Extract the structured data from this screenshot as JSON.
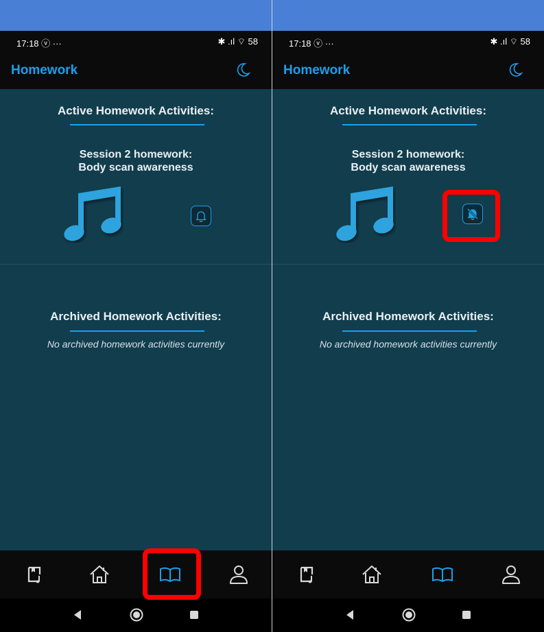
{
  "phones": [
    {
      "status": {
        "time": "17:18 ⓥ ···",
        "icons": "✱ .ıl ⌔ 58"
      },
      "header": {
        "title": "Homework",
        "theme_icon": "moon-icon"
      },
      "active": {
        "title": "Active Homework Activities:",
        "session_line1": "Session 2 homework:",
        "session_line2": "Body scan awareness",
        "media_icon": "music-note-icon",
        "reminder_icon": "bell-icon",
        "reminder_state": "on"
      },
      "archived": {
        "title": "Archived Homework Activities:",
        "empty_text": "No archived homework activities currently"
      },
      "nav": {
        "tabs": [
          "music-book-icon",
          "home-icon",
          "book-icon",
          "person-icon"
        ],
        "active_tab": "book-icon"
      },
      "highlight_target": "book-tab"
    },
    {
      "status": {
        "time": "17:18 ⓥ ···",
        "icons": "✱ .ıl ⌔ 58"
      },
      "header": {
        "title": "Homework",
        "theme_icon": "moon-icon"
      },
      "active": {
        "title": "Active Homework Activities:",
        "session_line1": "Session 2 homework:",
        "session_line2": "Body scan awareness",
        "media_icon": "music-note-icon",
        "reminder_icon": "bell-off-icon",
        "reminder_state": "off"
      },
      "archived": {
        "title": "Archived Homework Activities:",
        "empty_text": "No archived homework activities currently"
      },
      "nav": {
        "tabs": [
          "music-book-icon",
          "home-icon",
          "book-icon",
          "person-icon"
        ],
        "active_tab": "book-icon"
      },
      "highlight_target": "bell-button"
    }
  ],
  "colors": {
    "accent": "#1aa0ea",
    "content_bg": "#123d4d",
    "bar_bg": "#0b0b0c",
    "top_band": "#4a7fd6",
    "highlight": "#ff0000"
  }
}
